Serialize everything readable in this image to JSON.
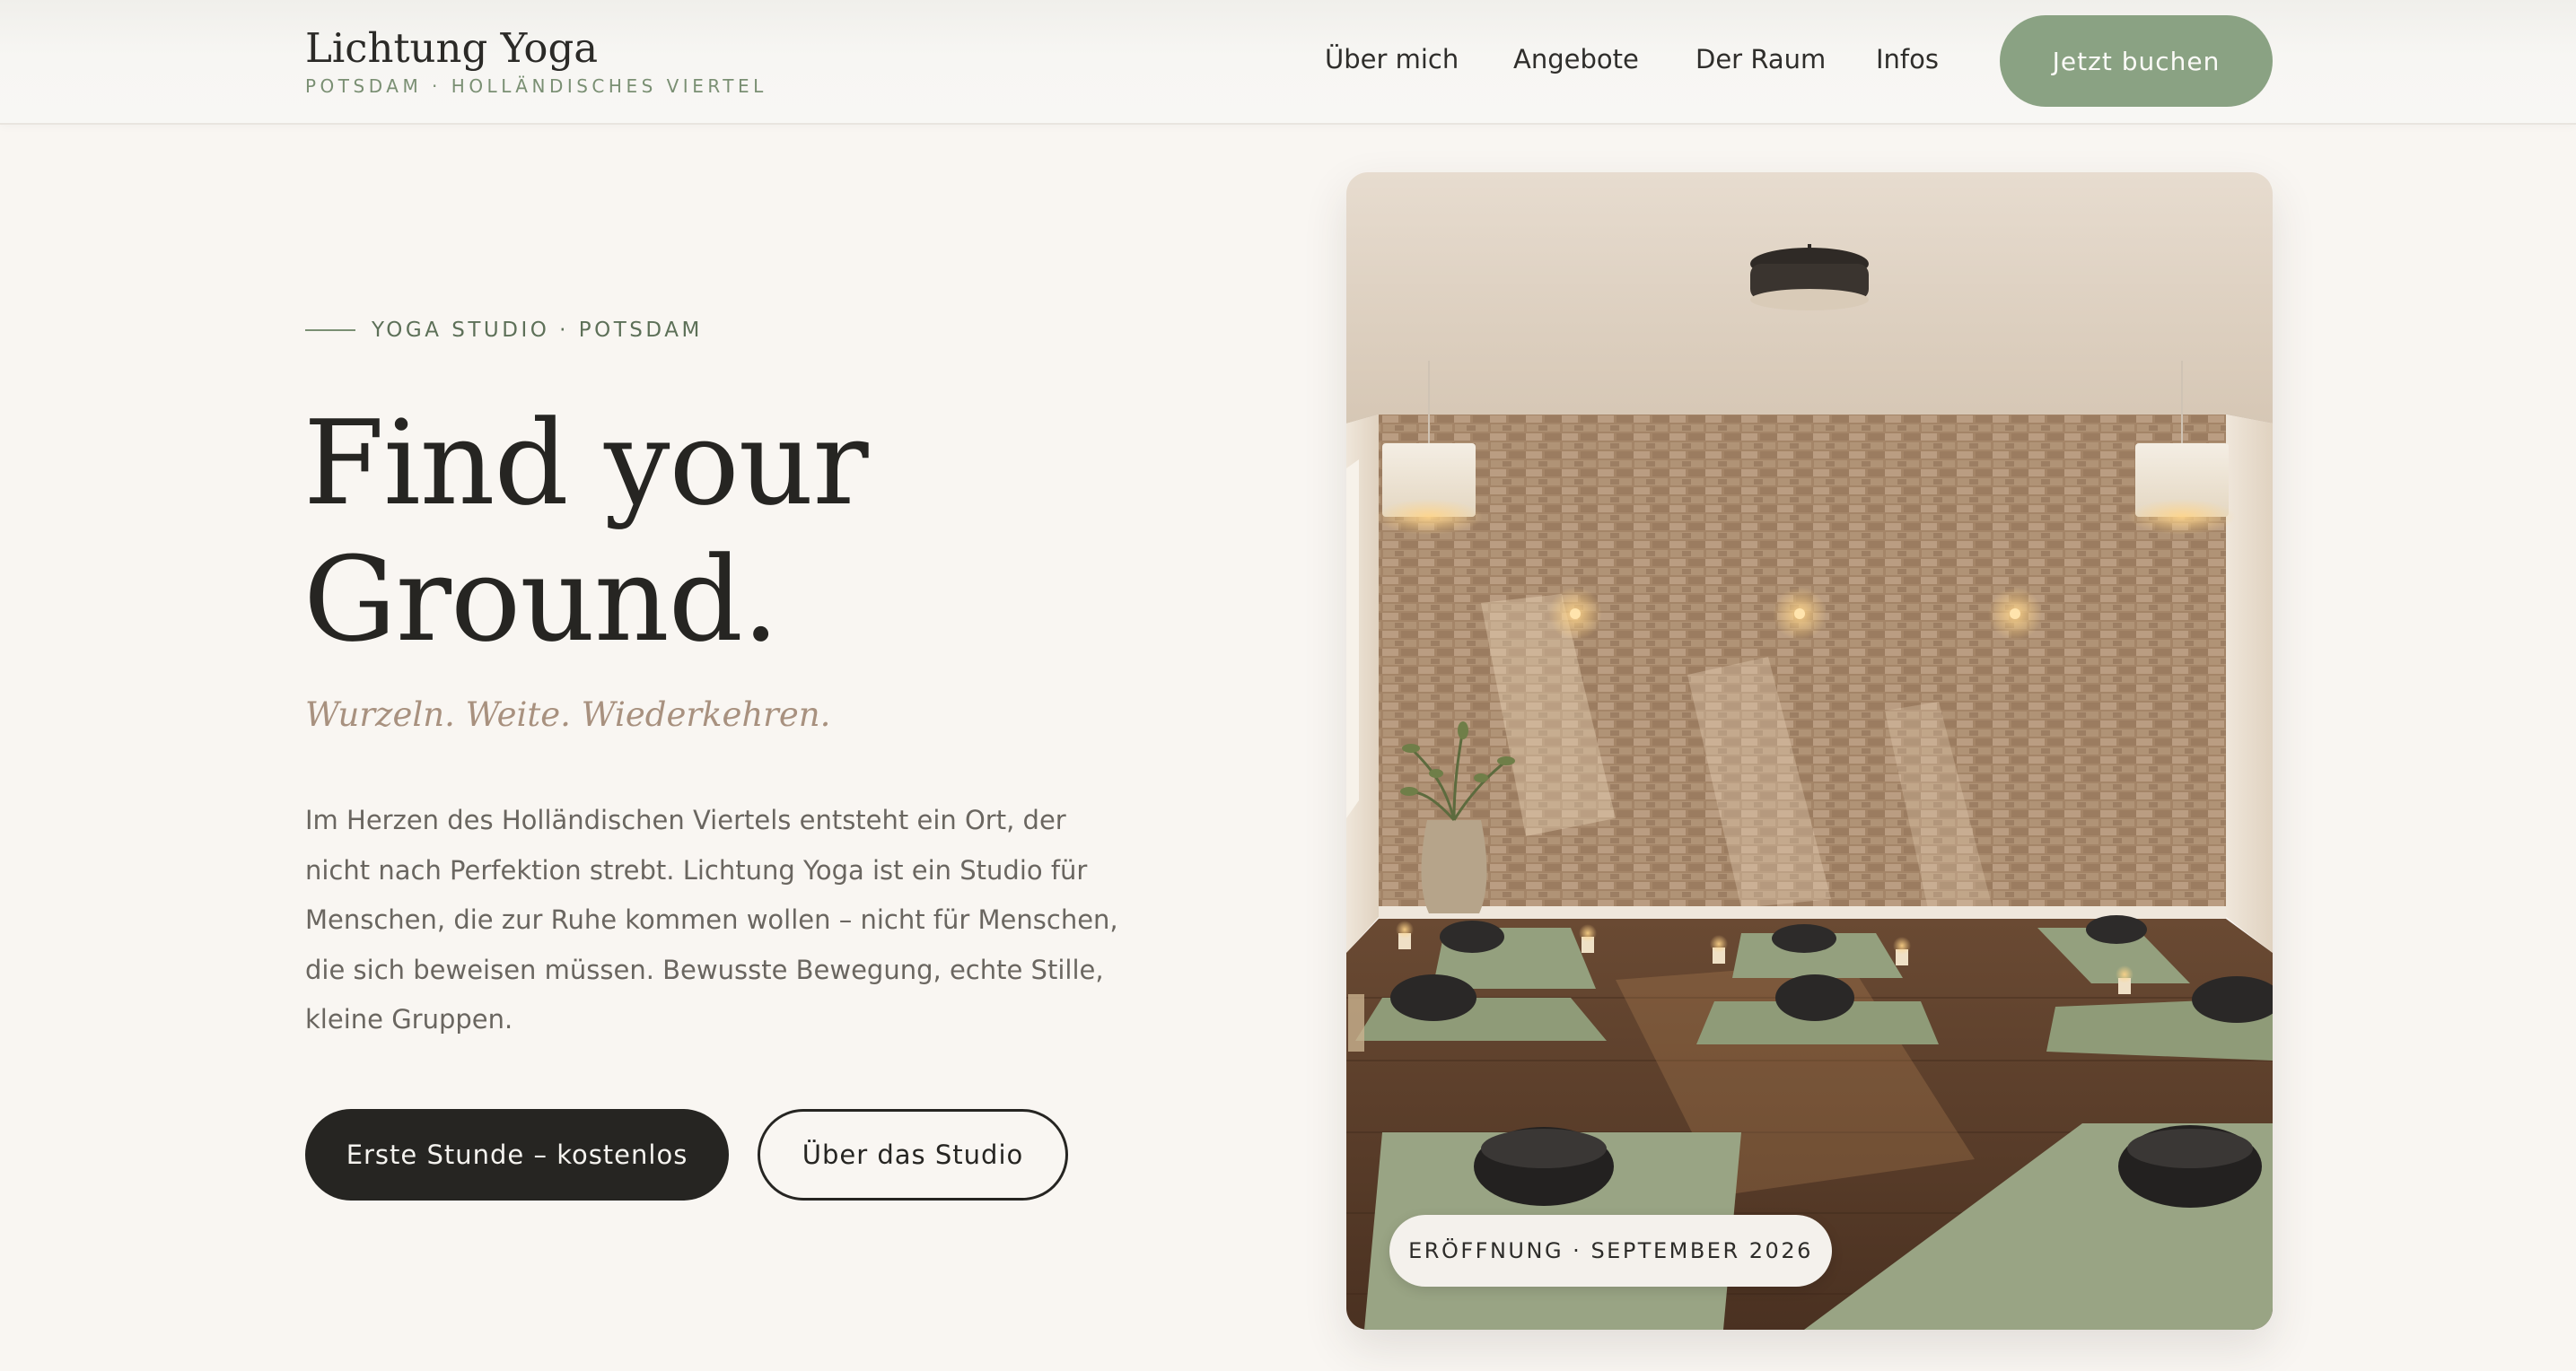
{
  "header": {
    "logo_title": "Lichtung Yoga",
    "logo_subtitle": "POTSDAM · HOLLÄNDISCHES VIERTEL",
    "nav": [
      "Über mich",
      "Angebote",
      "Der Raum",
      "Infos"
    ],
    "cta": "Jetzt buchen"
  },
  "hero": {
    "eyebrow": "YOGA STUDIO · POTSDAM",
    "headline": [
      "Find your",
      "Ground."
    ],
    "tagline": "Wurzeln. Weite. Wiederkehren.",
    "intro": [
      "Im Herzen des Holländischen Viertels entsteht ein Ort, der",
      "nicht nach Perfektion strebt. Lichtung Yoga ist ein Studio für",
      "Menschen, die zur Ruhe kommen wollen – nicht für Menschen,",
      "die sich beweisen müssen. Bewusste Bewegung, echte Stille,",
      "kleine Gruppen."
    ],
    "primary_cta": "Erste Stunde – kostenlos",
    "secondary_cta": "Über das Studio"
  },
  "photo": {
    "badge": "ERÖFFNUNG · SEPTEMBER 2026"
  },
  "colors": {
    "accent_green": "#8aa283",
    "eyebrow_green": "#5d7058",
    "tagline_rose": "#a8917f",
    "background": "#f9f6f2",
    "dark": "#262522"
  }
}
